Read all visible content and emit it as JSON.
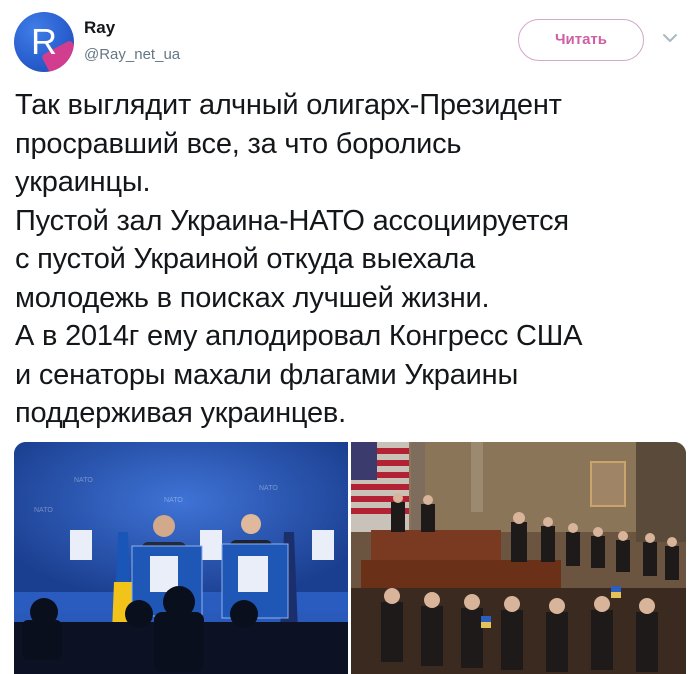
{
  "account": {
    "display_name": "Ray",
    "handle": "@Ray_net_ua",
    "avatar_letter": "R"
  },
  "actions": {
    "follow_label": "Читать"
  },
  "tweet": {
    "text": "Так выглядит алчный олигарх-Президент\nпросравший все, за что боролись\nукраинцы.\nПустой зал Украина-НАТО ассоциируется\nс пустой Украиной откуда выехала\nмолодежь в поисках лучшей жизни.\nА в 2014г ему аплодировал Конгресс США\nи сенаторы махали флагами Украины\nподдерживая украинцев."
  },
  "media": {
    "left_photo_text": [
      "NATO",
      "NATO",
      "NATO",
      "NATO"
    ],
    "colors": {
      "nato_blue": "#1f4aa8",
      "ukraine_blue": "#1a56b8",
      "ukraine_yellow": "#f2c318",
      "congress_wood": "#7a3a22"
    }
  }
}
